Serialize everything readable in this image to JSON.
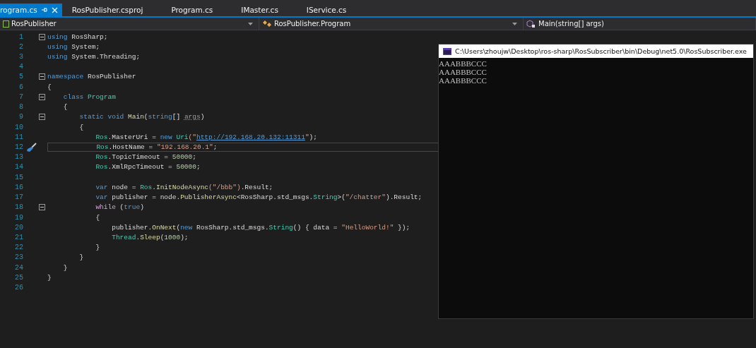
{
  "tabs": [
    {
      "label": "rogram.cs",
      "selected": true,
      "pinned": true
    },
    {
      "label": "RosPublisher.csproj",
      "selected": false,
      "pinned": false
    },
    {
      "label": "Program.cs",
      "selected": false,
      "pinned": false
    },
    {
      "label": "IMaster.cs",
      "selected": false,
      "pinned": false
    },
    {
      "label": "IService.cs",
      "selected": false,
      "pinned": false
    }
  ],
  "nav_bar": [
    {
      "kind": "project",
      "label": "RosPublisher"
    },
    {
      "kind": "class",
      "label": "RosPublisher.Program"
    },
    {
      "kind": "method",
      "label": "Main(string[] args)"
    }
  ],
  "editor": {
    "lines": [
      {
        "number": "1",
        "fold": true,
        "current": false,
        "tokens": [
          {
            "t": "using",
            "kind": "keyword"
          },
          {
            "t": " RosSharp;",
            "kind": "plain"
          }
        ]
      },
      {
        "number": "2",
        "fold": false,
        "current": false,
        "tokens": [
          {
            "t": "using",
            "kind": "keyword"
          },
          {
            "t": " System;",
            "kind": "plain"
          }
        ]
      },
      {
        "number": "3",
        "fold": false,
        "current": false,
        "tokens": [
          {
            "t": "using",
            "kind": "keyword"
          },
          {
            "t": " System.Threading;",
            "kind": "plain"
          }
        ]
      },
      {
        "number": "4",
        "fold": false,
        "current": false
      },
      {
        "number": "5",
        "fold": true,
        "current": false,
        "tokens": [
          {
            "t": "namespace",
            "kind": "keyword"
          },
          {
            "t": " RosPublisher",
            "kind": "plain"
          }
        ]
      },
      {
        "number": "6",
        "fold": false,
        "current": false,
        "tokens": [
          {
            "t": "{",
            "kind": "plain"
          }
        ]
      },
      {
        "number": "7",
        "fold": true,
        "current": false,
        "tokens": [
          {
            "t": "    class",
            "kind": "keyword"
          },
          {
            "t": " Program",
            "kind": "type"
          }
        ]
      },
      {
        "number": "8",
        "fold": false,
        "current": false,
        "tokens": [
          {
            "t": "    {",
            "kind": "plain"
          }
        ]
      },
      {
        "number": "9",
        "fold": true,
        "current": false,
        "tokens": [
          {
            "t": "        static void",
            "kind": "keyword"
          },
          {
            "t": " Main",
            "kind": "method"
          },
          {
            "t": "(",
            "kind": "plain"
          },
          {
            "t": "string",
            "kind": "keyword"
          },
          {
            "t": "[] ",
            "kind": "plain"
          },
          {
            "t": "args",
            "kind": "unused"
          },
          {
            "t": ")",
            "kind": "plain"
          }
        ]
      },
      {
        "number": "10",
        "fold": false,
        "current": false,
        "tokens": [
          {
            "t": "        {",
            "kind": "plain"
          }
        ]
      },
      {
        "number": "11",
        "fold": false,
        "current": false,
        "tokens": [
          {
            "t": "            Ros",
            "kind": "type"
          },
          {
            "t": ".MasterUri = ",
            "kind": "plain"
          },
          {
            "t": "new",
            "kind": "keyword"
          },
          {
            "t": " Uri",
            "kind": "type"
          },
          {
            "t": "(\"",
            "kind": "string"
          },
          {
            "t": "http://192.168.20.132:11311",
            "kind": "link"
          },
          {
            "t": "\"",
            "kind": "string"
          },
          {
            "t": ");",
            "kind": "plain"
          }
        ]
      },
      {
        "number": "12",
        "fold": false,
        "current": true,
        "tokens": [
          {
            "t": "            Ros",
            "kind": "type"
          },
          {
            "t": ".HostName = ",
            "kind": "plain"
          },
          {
            "t": "\"192.168.20.1\"",
            "kind": "string"
          },
          {
            "t": ";",
            "kind": "plain"
          }
        ]
      },
      {
        "number": "13",
        "fold": false,
        "current": false,
        "tokens": [
          {
            "t": "            Ros",
            "kind": "type"
          },
          {
            "t": ".TopicTimeout = ",
            "kind": "plain"
          },
          {
            "t": "50000",
            "kind": "number"
          },
          {
            "t": ";",
            "kind": "plain"
          }
        ]
      },
      {
        "number": "14",
        "fold": false,
        "current": false,
        "tokens": [
          {
            "t": "            Ros",
            "kind": "type"
          },
          {
            "t": ".XmlRpcTimeout = ",
            "kind": "plain"
          },
          {
            "t": "50000",
            "kind": "number"
          },
          {
            "t": ";",
            "kind": "plain"
          }
        ]
      },
      {
        "number": "15",
        "fold": false,
        "current": false
      },
      {
        "number": "16",
        "fold": false,
        "current": false,
        "tokens": [
          {
            "t": "            var",
            "kind": "keyword"
          },
          {
            "t": " node = ",
            "kind": "plain"
          },
          {
            "t": "Ros",
            "kind": "type"
          },
          {
            "t": ".",
            "kind": "plain"
          },
          {
            "t": "InitNodeAsync",
            "kind": "method"
          },
          {
            "t": "(\"/bbb\")",
            "kind": "string"
          },
          {
            "t": ".Result;",
            "kind": "plain"
          }
        ]
      },
      {
        "number": "17",
        "fold": false,
        "current": false,
        "tokens": [
          {
            "t": "            var",
            "kind": "keyword"
          },
          {
            "t": " publisher = node.",
            "kind": "plain"
          },
          {
            "t": "PublisherAsync",
            "kind": "method"
          },
          {
            "t": "<RosSharp.std_msgs.",
            "kind": "plain"
          },
          {
            "t": "String",
            "kind": "type"
          },
          {
            "t": ">(",
            "kind": "plain"
          },
          {
            "t": "\"/chatter\"",
            "kind": "string"
          },
          {
            "t": ").Result;",
            "kind": "plain"
          }
        ]
      },
      {
        "number": "18",
        "fold": true,
        "current": false,
        "tokens": [
          {
            "t": "            while",
            "kind": "control"
          },
          {
            "t": " (",
            "kind": "plain"
          },
          {
            "t": "true",
            "kind": "keyword"
          },
          {
            "t": ")",
            "kind": "plain"
          }
        ]
      },
      {
        "number": "19",
        "fold": false,
        "current": false,
        "tokens": [
          {
            "t": "            {",
            "kind": "plain"
          }
        ]
      },
      {
        "number": "20",
        "fold": false,
        "current": false,
        "tokens": [
          {
            "t": "                publisher.",
            "kind": "plain"
          },
          {
            "t": "OnNext",
            "kind": "method"
          },
          {
            "t": "(",
            "kind": "plain"
          },
          {
            "t": "new",
            "kind": "keyword"
          },
          {
            "t": " RosSharp.std_msgs.",
            "kind": "plain"
          },
          {
            "t": "String",
            "kind": "type"
          },
          {
            "t": "() { data = ",
            "kind": "plain"
          },
          {
            "t": "\"HelloWorld!\"",
            "kind": "string"
          },
          {
            "t": " });",
            "kind": "plain"
          }
        ]
      },
      {
        "number": "21",
        "fold": false,
        "current": false,
        "tokens": [
          {
            "t": "                Thread",
            "kind": "type"
          },
          {
            "t": ".",
            "kind": "plain"
          },
          {
            "t": "Sleep",
            "kind": "method"
          },
          {
            "t": "(",
            "kind": "plain"
          },
          {
            "t": "1000",
            "kind": "number"
          },
          {
            "t": ");",
            "kind": "plain"
          }
        ]
      },
      {
        "number": "22",
        "fold": false,
        "current": false,
        "tokens": [
          {
            "t": "            }",
            "kind": "plain"
          }
        ]
      },
      {
        "number": "23",
        "fold": false,
        "current": false,
        "tokens": [
          {
            "t": "        }",
            "kind": "plain"
          }
        ]
      },
      {
        "number": "24",
        "fold": false,
        "current": false,
        "tokens": [
          {
            "t": "    }",
            "kind": "plain"
          }
        ]
      },
      {
        "number": "25",
        "fold": false,
        "current": false,
        "tokens": [
          {
            "t": "}",
            "kind": "plain"
          }
        ]
      },
      {
        "number": "26",
        "fold": false,
        "current": false
      }
    ]
  },
  "console": {
    "title": "C:\\Users\\zhoujw\\Desktop\\ros-sharp\\RosSubscriber\\bin\\Debug\\net5.0\\RosSubscriber.exe",
    "output": [
      "AAABBBCCC",
      "AAABBBCCC",
      "AAABBBCCC"
    ]
  }
}
